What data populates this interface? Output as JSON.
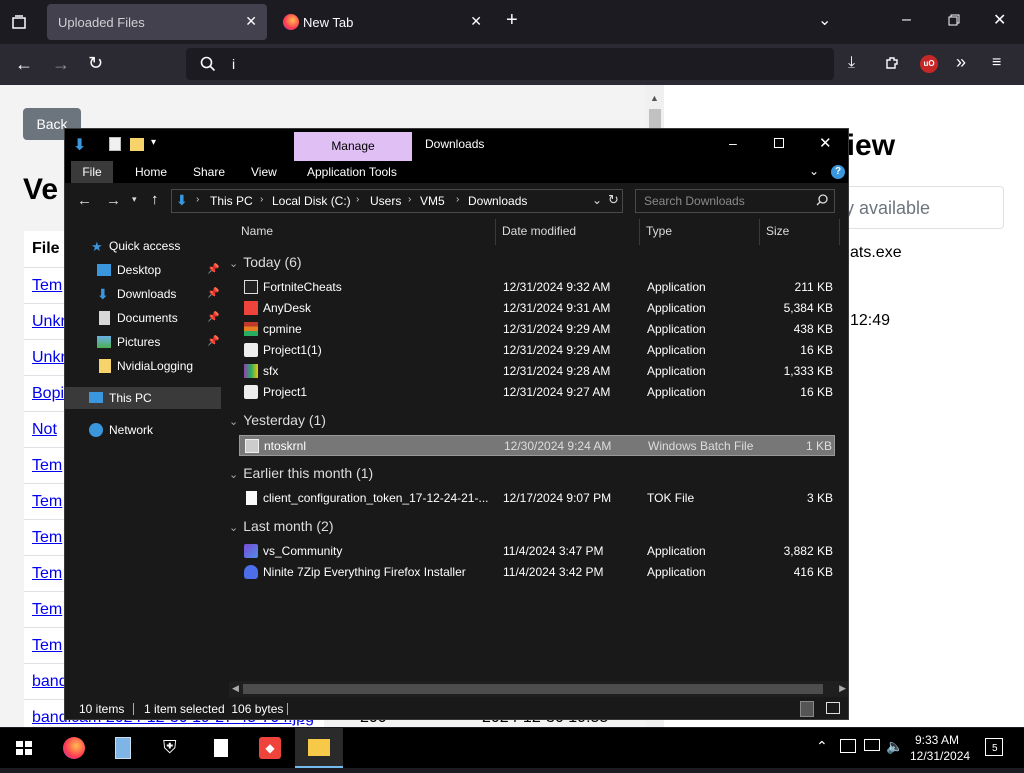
{
  "browser": {
    "tabs": [
      {
        "label": "Uploaded Files",
        "active": true
      },
      {
        "label": "New Tab",
        "active": false
      }
    ],
    "url": "i",
    "accent": "#42414d"
  },
  "page": {
    "back_label": "Back",
    "heading_left": "Ve",
    "heading_right": "view",
    "table_header": "File",
    "links": [
      "Tem",
      "Unkn",
      "Unkn",
      "Bopi",
      "Not",
      "Tem",
      "Tem",
      "Tem",
      "Tem",
      "Tem",
      "Tem",
      "band",
      "bandicam 2024-12-30 19-27-45-704.jpg"
    ],
    "right_input_placeholder": "y available",
    "right_file": "ats.exe",
    "right_time": "12:49",
    "bottom_cell_1": "200",
    "bottom_cell_2": "2024-12-30 19:55"
  },
  "explorer": {
    "title": "Downloads",
    "manage_tab": "Manage",
    "ribbon_tabs": [
      "File",
      "Home",
      "Share",
      "View",
      "Application Tools"
    ],
    "breadcrumb": [
      "This PC",
      "Local Disk (C:)",
      "Users",
      "VM5",
      "Downloads"
    ],
    "search_placeholder": "Search Downloads",
    "nav": [
      {
        "label": "Quick access",
        "icon": "star-icon",
        "pinned": false
      },
      {
        "label": "Desktop",
        "icon": "desktop-icon",
        "pinned": true
      },
      {
        "label": "Downloads",
        "icon": "download-icon",
        "pinned": true
      },
      {
        "label": "Documents",
        "icon": "document-icon",
        "pinned": true
      },
      {
        "label": "Pictures",
        "icon": "picture-icon",
        "pinned": true
      },
      {
        "label": "NvidiaLogging",
        "icon": "folder-icon",
        "pinned": false
      },
      {
        "label": "This PC",
        "icon": "computer-icon",
        "pinned": false
      },
      {
        "label": "Network",
        "icon": "network-icon",
        "pinned": false
      }
    ],
    "columns": [
      "Name",
      "Date modified",
      "Type",
      "Size"
    ],
    "groups": [
      {
        "label": "Today (6)",
        "files": [
          {
            "name": "FortniteCheats",
            "date": "12/31/2024 9:32 AM",
            "type": "Application",
            "size": "211 KB",
            "icon": "app-icon"
          },
          {
            "name": "AnyDesk",
            "date": "12/31/2024 9:31 AM",
            "type": "Application",
            "size": "5,384 KB",
            "icon": "anydesk-icon"
          },
          {
            "name": "cpmine",
            "date": "12/31/2024 9:29 AM",
            "type": "Application",
            "size": "438 KB",
            "icon": "app-icon"
          },
          {
            "name": "Project1(1)",
            "date": "12/31/2024 9:29 AM",
            "type": "Application",
            "size": "16 KB",
            "icon": "app-icon"
          },
          {
            "name": "sfx",
            "date": "12/31/2024 9:28 AM",
            "type": "Application",
            "size": "1,333 KB",
            "icon": "archive-icon"
          },
          {
            "name": "Project1",
            "date": "12/31/2024 9:27 AM",
            "type": "Application",
            "size": "16 KB",
            "icon": "app-icon"
          }
        ]
      },
      {
        "label": "Yesterday (1)",
        "files": [
          {
            "name": "ntoskrnl",
            "date": "12/30/2024 9:24 AM",
            "type": "Windows Batch File",
            "size": "1 KB",
            "icon": "batch-file-icon",
            "selected": true
          }
        ]
      },
      {
        "label": "Earlier this month (1)",
        "files": [
          {
            "name": "client_configuration_token_17-12-24-21-...",
            "date": "12/17/2024 9:07 PM",
            "type": "TOK File",
            "size": "3 KB",
            "icon": "file-icon"
          }
        ]
      },
      {
        "label": "Last month (2)",
        "files": [
          {
            "name": "vs_Community",
            "date": "11/4/2024 3:47 PM",
            "type": "Application",
            "size": "3,882 KB",
            "icon": "visual-studio-icon"
          },
          {
            "name": "Ninite 7Zip Everything Firefox Installer",
            "date": "11/4/2024 3:42 PM",
            "type": "Application",
            "size": "416 KB",
            "icon": "ninite-icon"
          }
        ]
      }
    ],
    "status": {
      "items": "10 items",
      "selected": "1 item selected  106 bytes"
    }
  },
  "taskbar": {
    "time": "9:33 AM",
    "date": "12/31/2024",
    "notifications": "5"
  }
}
